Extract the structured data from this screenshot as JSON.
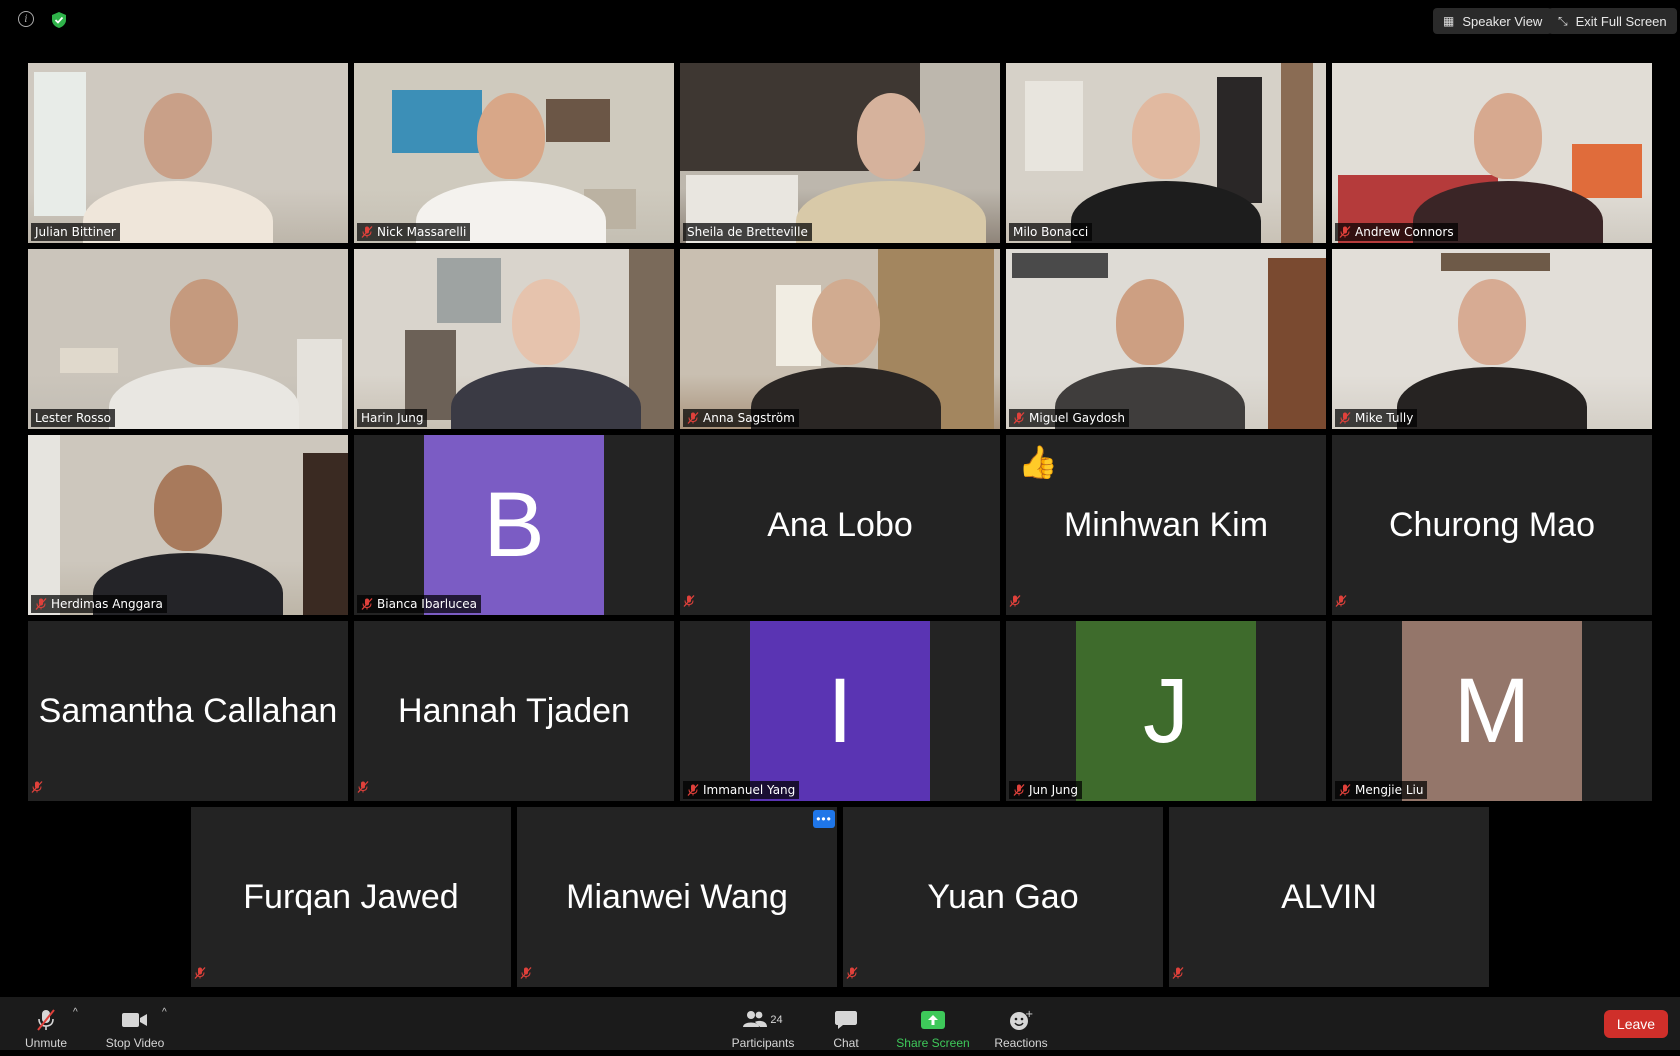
{
  "top_bar": {
    "speaker_view_label": "Speaker View",
    "exit_full_screen_label": "Exit Full Screen"
  },
  "participants": [
    {
      "name": "Julian Bittiner",
      "video": true,
      "muted": false,
      "active_speaker": true
    },
    {
      "name": "Nick Massarelli",
      "video": true,
      "muted": true
    },
    {
      "name": "Sheila de Bretteville",
      "video": true,
      "muted": false
    },
    {
      "name": "Milo Bonacci",
      "video": true,
      "muted": false
    },
    {
      "name": "Andrew Connors",
      "video": true,
      "muted": true
    },
    {
      "name": "Lester Rosso",
      "video": true,
      "muted": false
    },
    {
      "name": "Harin Jung",
      "video": true,
      "muted": false
    },
    {
      "name": "Anna Sagström",
      "video": true,
      "muted": true
    },
    {
      "name": "Miguel Gaydosh",
      "video": true,
      "muted": true
    },
    {
      "name": "Mike Tully",
      "video": true,
      "muted": true
    },
    {
      "name": "Herdimas Anggara",
      "video": true,
      "muted": true
    },
    {
      "name": "Bianca Ibarlucea",
      "video": false,
      "muted": true,
      "avatar_letter": "B",
      "avatar_color": "#7b5cc4"
    },
    {
      "name": "Ana Lobo",
      "video": false,
      "muted": true
    },
    {
      "name": "Minhwan Kim",
      "video": false,
      "muted": true,
      "reaction": "thumbs-up"
    },
    {
      "name": "Churong Mao",
      "video": false,
      "muted": true
    },
    {
      "name": "Samantha Callahan",
      "video": false,
      "muted": true
    },
    {
      "name": "Hannah Tjaden",
      "video": false,
      "muted": true
    },
    {
      "name": "Immanuel Yang",
      "video": false,
      "muted": true,
      "avatar_letter": "I",
      "avatar_color": "#5a34b3"
    },
    {
      "name": "Jun Jung",
      "video": false,
      "muted": true,
      "avatar_letter": "J",
      "avatar_color": "#3e6b2c"
    },
    {
      "name": "Mengjie Liu",
      "video": false,
      "muted": true,
      "avatar_letter": "M",
      "avatar_color": "#94766a"
    },
    {
      "name": "Furqan Jawed",
      "video": false,
      "muted": true
    },
    {
      "name": "Mianwei Wang",
      "video": false,
      "muted": true,
      "more_menu": true
    },
    {
      "name": "Yuan Gao",
      "video": false,
      "muted": true
    },
    {
      "name": "ALVIN",
      "video": false,
      "muted": true
    }
  ],
  "toolbar": {
    "unmute_label": "Unmute",
    "stop_video_label": "Stop Video",
    "participants_label": "Participants",
    "participants_count": "24",
    "chat_label": "Chat",
    "share_screen_label": "Share Screen",
    "reactions_label": "Reactions",
    "leave_label": "Leave"
  },
  "colors": {
    "active_speaker_border": "#e6ec8b",
    "share_green": "#3ec95a",
    "leave_red": "#cf2f2a",
    "tile_bg": "#232323"
  }
}
